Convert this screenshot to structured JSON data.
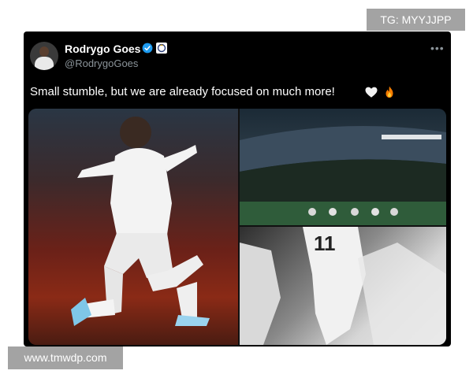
{
  "watermarks": {
    "top": "TG: MYYJJPP",
    "bottom": "www.tmwdp.com"
  },
  "tweet": {
    "author_name": "Rodrygo Goes",
    "handle": "@RodrygoGoes",
    "text": "Small stumble, but we are already focused on much more!",
    "emojis": [
      "white-heart-icon",
      "fire-icon"
    ],
    "badges": [
      "verified-icon",
      "affiliate-badge-icon"
    ],
    "accent_color": "#1d9bf0"
  },
  "media": {
    "images": [
      "player-celebration-photo",
      "stadium-crowd-photo",
      "players-black-white-photo"
    ]
  }
}
